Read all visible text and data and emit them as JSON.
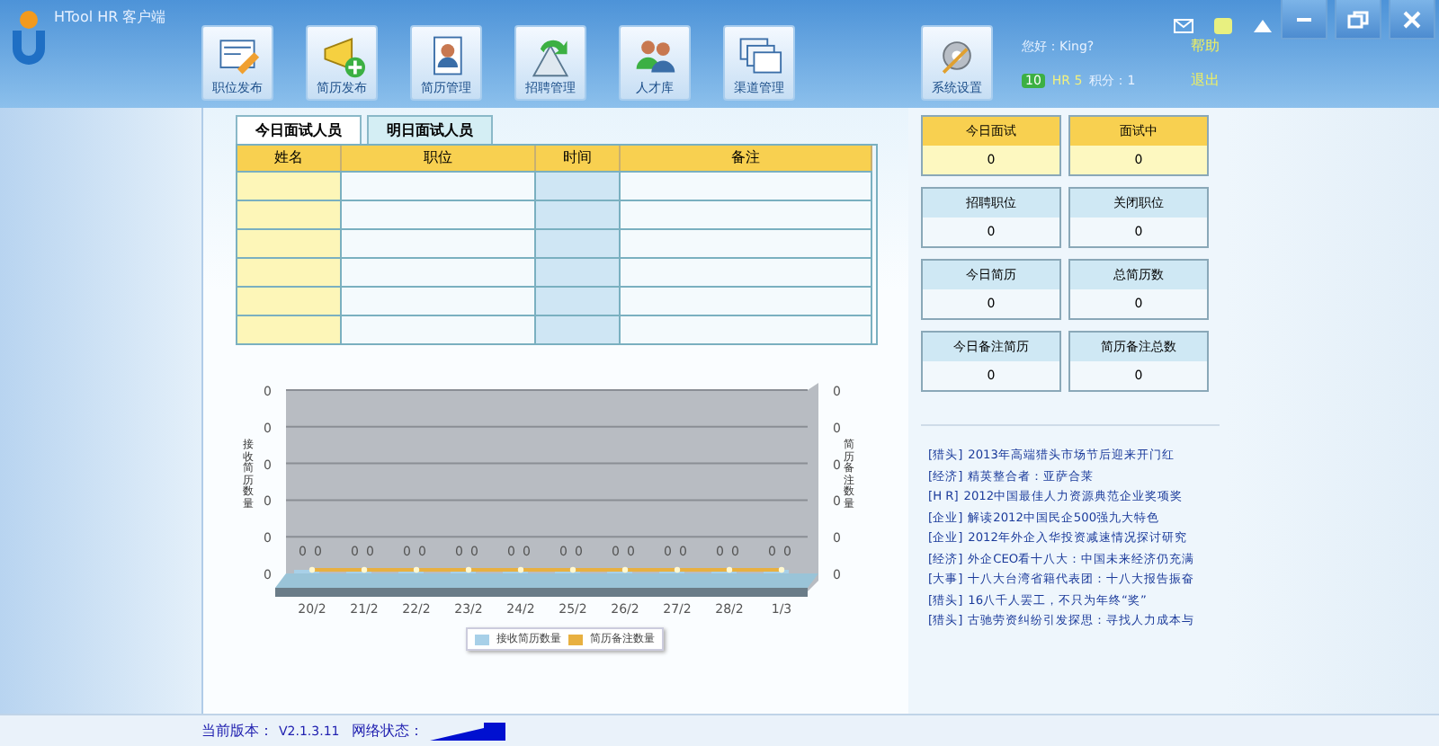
{
  "window": {
    "title": "HTool HR 客户端"
  },
  "toolbar": [
    {
      "label": "职位发布"
    },
    {
      "label": "简历发布"
    },
    {
      "label": "简历管理"
    },
    {
      "label": "招聘管理"
    },
    {
      "label": "人才库"
    },
    {
      "label": "渠道管理"
    },
    {
      "label": "系统设置"
    }
  ],
  "user": {
    "greeting": "您好：King?",
    "help": "帮助",
    "level": "10",
    "rank": "HR 5",
    "points": "积分：1",
    "logout": "退出"
  },
  "tabs": [
    {
      "label": "今日面试人员",
      "selected": true
    },
    {
      "label": "明日面试人员",
      "selected": false
    }
  ],
  "table": {
    "columns": [
      "姓名",
      "职位",
      "时间",
      "备注"
    ]
  },
  "stats": [
    {
      "label": "今日面试",
      "value": "0",
      "kind": "highlight"
    },
    {
      "label": "面试中",
      "value": "0",
      "kind": "highlight"
    },
    {
      "label": "招聘职位",
      "value": "0",
      "kind": "normal"
    },
    {
      "label": "关闭职位",
      "value": "0",
      "kind": "normal"
    },
    {
      "label": "今日简历",
      "value": "0",
      "kind": "normal"
    },
    {
      "label": "总简历数",
      "value": "0",
      "kind": "normal"
    },
    {
      "label": "今日备注简历",
      "value": "0",
      "kind": "normal"
    },
    {
      "label": "简历备注总数",
      "value": "0",
      "kind": "normal"
    }
  ],
  "chart": {
    "ylabel": "接收简历数量",
    "y2label": "简历备注数量",
    "x_labels": [
      "20/2",
      "21/2",
      "22/2",
      "23/2",
      "24/2",
      "25/2",
      "26/2",
      "27/2",
      "28/2",
      "1/3"
    ],
    "y_axis_labels": [
      "0",
      "0",
      "0",
      "0",
      "0",
      "0"
    ],
    "y2_axis_labels": [
      "0",
      "0",
      "0",
      "0",
      "0",
      "0"
    ],
    "points": [
      {
        "bar_label": "0",
        "line_label": "0"
      },
      {
        "bar_label": "0",
        "line_label": "0"
      },
      {
        "bar_label": "0",
        "line_label": "0"
      },
      {
        "bar_label": "0",
        "line_label": "0"
      },
      {
        "bar_label": "0",
        "line_label": "0"
      },
      {
        "bar_label": "0",
        "line_label": "0"
      },
      {
        "bar_label": "0",
        "line_label": "0"
      },
      {
        "bar_label": "0",
        "line_label": "0"
      },
      {
        "bar_label": "0",
        "line_label": "0"
      },
      {
        "bar_label": "0",
        "line_label": "0"
      }
    ],
    "legend": [
      {
        "name": "接收简历数量",
        "color": "#a8d0e8",
        "kind": "bar"
      },
      {
        "name": "简历备注数量",
        "color": "#e8b040",
        "kind": "line"
      }
    ]
  },
  "news": [
    {
      "tag": "[猎头]",
      "text": "2013年高端猎头市场节后迎来开门红"
    },
    {
      "tag": "[经济]",
      "text": "精英整合者：亚萨合莱"
    },
    {
      "tag": "[H R]",
      "text": "2012中国最佳人力资源典范企业奖项奖"
    },
    {
      "tag": "[企业]",
      "text": "解读2012中国民企500强九大特色"
    },
    {
      "tag": "[企业]",
      "text": "2012年外企入华投资减速情况探讨研究"
    },
    {
      "tag": "[经济]",
      "text": "外企CEO看十八大：中国未来经济仍充满"
    },
    {
      "tag": "[大事]",
      "text": "十八大台湾省籍代表团：十八大报告振奋"
    },
    {
      "tag": "[猎头]",
      "text": "16八千人罢工，不只为年终“奖”"
    },
    {
      "tag": "[猎头]",
      "text": "古驰劳资纠纷引发探思：寻找人力成本与"
    }
  ],
  "status_bar": {
    "version_label": "当前版本：",
    "version": "V2.1.3.11",
    "network_label": "网络状态："
  }
}
